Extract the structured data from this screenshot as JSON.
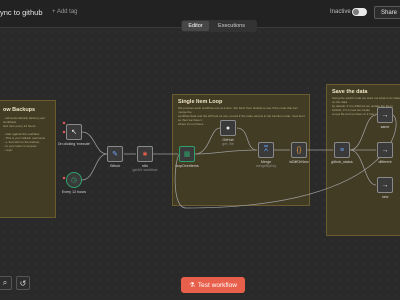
{
  "header": {
    "workflow_title": "ync to github",
    "add_tag": "+ Add tag",
    "status_label": "Inactive",
    "share_label": "Share"
  },
  "tabs": [
    {
      "label": "Editor",
      "active": true
    },
    {
      "label": "Executions",
      "active": false
    }
  ],
  "stickies": {
    "backups": {
      "title": "ow Backups",
      "body": "...will automatically backup your workflows\nand runs every 12 hours.\n\n...start against the workflow\n...This is your GitHub username\n...s, that will run the backup\n...to your token is scoped\n...'repo'"
    },
    "loop": {
      "title": "Single Item Loop",
      "body": "We process each workflow one at a time. We fetch from GitHub to see if the node that can merge the\nworkflow data and the API lets us use; record if the node returns in the function node. 'next item' so then we have it\nwhere it's not there..."
    },
    "save": {
      "title": "Save the data",
      "body": "Using the switch node we work out what to do based on the data\nby default. If it is different we update the file in GitHub, if it is new we create\na new file and so have no it has not changed."
    }
  },
  "nodes": [
    {
      "name": "On clicking 'execute'",
      "icon": "cursor-icon"
    },
    {
      "name": "Every 12 hours",
      "icon": "clock-icon"
    },
    {
      "name": "Github",
      "icon": "pen-icon"
    },
    {
      "name": "n8n",
      "sub": "getAll: workflow",
      "icon": "n8n-icon"
    },
    {
      "name": "loopOverItems",
      "icon": "loop-icon"
    },
    {
      "name": "GitHub",
      "sub": "get: file",
      "icon": "github-icon"
    },
    {
      "name": "Merge",
      "sub": "mergeByKey",
      "icon": "merge-icon"
    },
    {
      "name": "isDiffOrNew",
      "icon": "code-icon"
    },
    {
      "name": "github_status",
      "icon": "switch-icon"
    },
    {
      "name": "same",
      "icon": "arrow-right-icon"
    },
    {
      "name": "different",
      "icon": "arrow-right-icon"
    },
    {
      "name": "new",
      "icon": "arrow-right-icon"
    }
  ],
  "footer": {
    "test_label": "Test workflow"
  },
  "colors": {
    "accent": "#e8604c",
    "sticky_bg": "#433c24",
    "node_border": "#8a8a8a",
    "trigger_green": "#2fa16b"
  }
}
